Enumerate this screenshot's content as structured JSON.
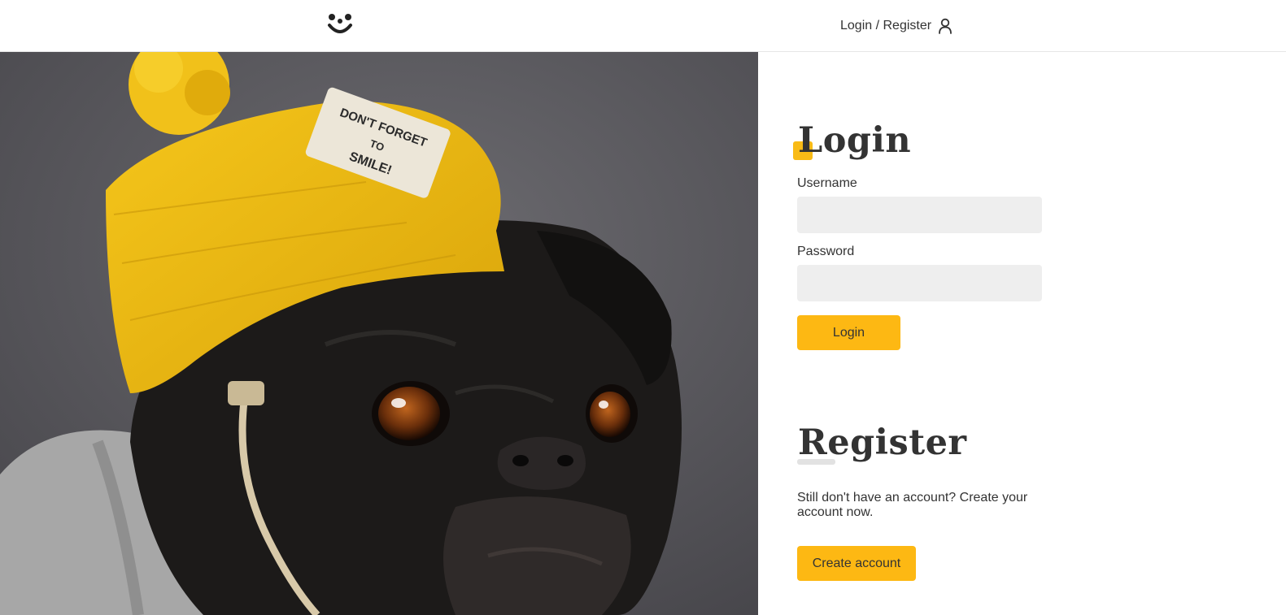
{
  "header": {
    "logo_icon": "bear-face-icon",
    "auth_link_label": "Login / Register",
    "user_icon": "user-icon"
  },
  "hero": {
    "image": "pug-wearing-yellow-beanie",
    "hat_patch_lines": [
      "DON'T FORGET",
      "TO",
      "SMILE!"
    ]
  },
  "login": {
    "title": "Login",
    "username_label": "Username",
    "username_value": "",
    "password_label": "Password",
    "password_value": "",
    "submit_label": "Login"
  },
  "register": {
    "title": "Register",
    "description": "Still don't have an account? Create your account now.",
    "button_label": "Create account"
  },
  "colors": {
    "accent": "#fdb813",
    "input_bg": "#eeeeee",
    "text": "#333333"
  }
}
